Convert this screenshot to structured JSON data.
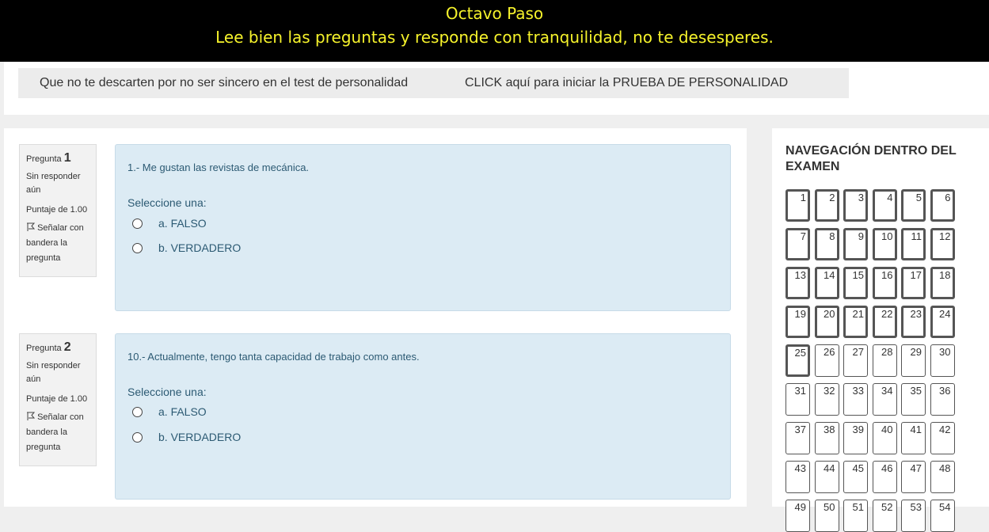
{
  "banner": {
    "line1": "Octavo Paso",
    "line2": "Lee bien las preguntas y responde con tranquilidad, no te desesperes."
  },
  "breadcrumb": [
    {
      "label": "Que no te descarten por no ser sincero en el test de personalidad"
    },
    {
      "label": "CLICK aquí para iniciar la PRUEBA DE PERSONALIDAD"
    }
  ],
  "questions": [
    {
      "info": {
        "title": "Pregunta",
        "number": "1",
        "state": "Sin responder aún",
        "score": "Puntaje de 1.00",
        "flag": "Señalar con bandera la pregunta"
      },
      "text": "1.- Me gustan las revistas de mecánica.",
      "prompt": "Seleccione una:",
      "options": [
        "a. FALSO",
        "b. VERDADERO"
      ]
    },
    {
      "info": {
        "title": "Pregunta",
        "number": "2",
        "state": "Sin responder aún",
        "score": "Puntaje de 1.00",
        "flag": "Señalar con bandera la pregunta"
      },
      "text": "10.- Actualmente, tengo tanta capacidad de trabajo como antes.",
      "prompt": "Seleccione una:",
      "options": [
        "a. FALSO",
        "b. VERDADERO"
      ]
    }
  ],
  "navigation": {
    "title": "NAVEGACIÓN DENTRO DEL EXAMEN",
    "buttons": [
      "1",
      "2",
      "3",
      "4",
      "5",
      "6",
      "7",
      "8",
      "9",
      "10",
      "11",
      "12",
      "13",
      "14",
      "15",
      "16",
      "17",
      "18",
      "19",
      "20",
      "21",
      "22",
      "23",
      "24",
      "25",
      "26",
      "27",
      "28",
      "29",
      "30",
      "31",
      "32",
      "33",
      "34",
      "35",
      "36",
      "37",
      "38",
      "39",
      "40",
      "41",
      "42",
      "43",
      "44",
      "45",
      "46",
      "47",
      "48",
      "49",
      "50",
      "51",
      "52",
      "53",
      "54"
    ],
    "highlighted_through": 25
  },
  "colors": {
    "banner_bg": "#000000",
    "banner_text": "#f6f32b",
    "question_bg": "#dcebf4",
    "question_text": "#2c5a73"
  },
  "icons": {
    "flag": "flag-icon",
    "radio": "radio-icon"
  }
}
